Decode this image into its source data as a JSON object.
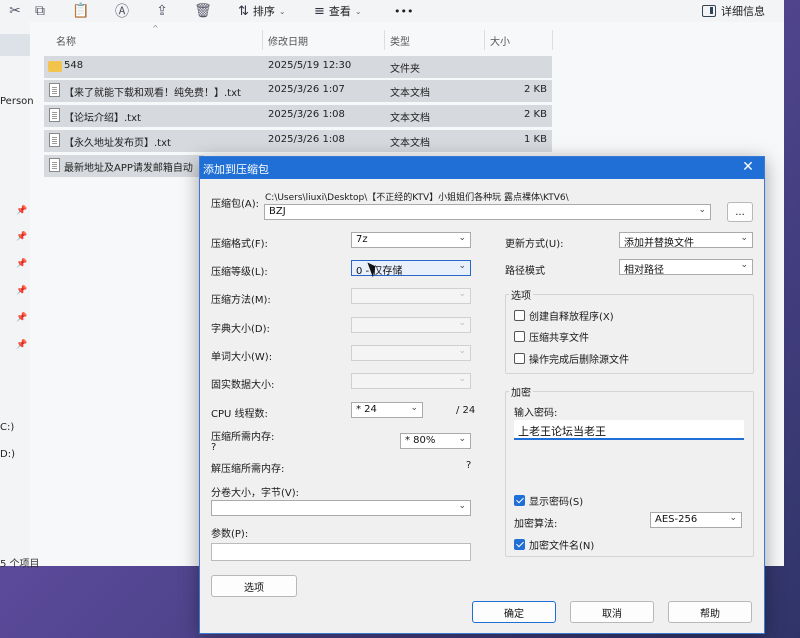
{
  "toolbar": {
    "sort_label": "排序",
    "view_label": "查看",
    "more_label": "•••",
    "details_label": "详细信息"
  },
  "nav": {
    "person_label": "Person",
    "drive_c": "C:)",
    "drive_d": "D:)",
    "item_count": "5 个项目"
  },
  "columns": {
    "name": "名称",
    "date": "修改日期",
    "type": "类型",
    "size": "大小"
  },
  "files": [
    {
      "name": "548",
      "date": "2025/5/19 12:30",
      "type": "文件夹",
      "size": ""
    },
    {
      "name": "【来了就能下载和观看！纯免费！】.txt",
      "date": "2025/3/26 1:07",
      "type": "文本文档",
      "size": "2 KB"
    },
    {
      "name": "【论坛介绍】.txt",
      "date": "2025/3/26 1:08",
      "type": "文本文档",
      "size": "2 KB"
    },
    {
      "name": "【永久地址发布页】.txt",
      "date": "2025/3/26 1:08",
      "type": "文本文档",
      "size": "1 KB"
    },
    {
      "name": "最新地址及APP请发邮箱自动",
      "date": "",
      "type": "",
      "size": ""
    }
  ],
  "dialog": {
    "title": "添加到压缩包",
    "close": "✕",
    "archive_label": "压缩包(A):",
    "archive_path": "C:\\Users\\liuxi\\Desktop\\【不正经的KTV】小姐姐们各种玩 露点裸体\\KTV6\\",
    "archive_name": "BZJ",
    "browse_label": "...",
    "format_label": "压缩格式(F):",
    "format_value": "7z",
    "level_label": "压缩等级(L):",
    "level_value": "0 - 仅存储",
    "method_label": "压缩方法(M):",
    "dict_label": "字典大小(D):",
    "word_label": "单词大小(W):",
    "solid_label": "固实数据大小:",
    "cpu_label": "CPU 线程数:",
    "cpu_value": "* 24",
    "cpu_total": "/ 24",
    "mem_comp_label": "压缩所需内存:",
    "mem_comp_value": "?",
    "mem_pct": "* 80%",
    "mem_decomp_label": "解压缩所需内存:",
    "mem_decomp_value": "?",
    "split_label": "分卷大小，字节(V):",
    "params_label": "参数(P):",
    "options_btn": "选项",
    "update_label": "更新方式(U):",
    "update_value": "添加并替换文件",
    "path_label": "路径模式",
    "path_value": "相对路径",
    "options_group": "选项",
    "opt_sfx": "创建自释放程序(X)",
    "opt_shared": "压缩共享文件",
    "opt_delete": "操作完成后删除源文件",
    "encrypt_group": "加密",
    "pwd_label": "输入密码:",
    "pwd_value": "上老王论坛当老王",
    "show_pwd": "显示密码(S)",
    "enc_method_label": "加密算法:",
    "enc_method_value": "AES-256",
    "enc_names": "加密文件名(N)",
    "ok": "确定",
    "cancel": "取消",
    "help": "帮助"
  }
}
